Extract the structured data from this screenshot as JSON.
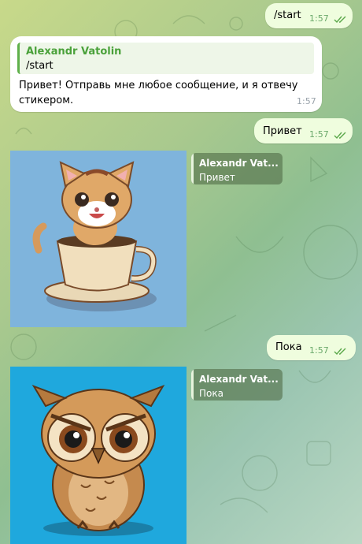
{
  "chat": {
    "messages": [
      {
        "id": "m1",
        "text": "/start",
        "time": "1:57"
      },
      {
        "id": "m2",
        "reply_name": "Alexandr Vatolin",
        "reply_text": "/start",
        "text": "Привет! Отправь мне любое сообщение, и я отвечу стикером.",
        "time": "1:57"
      },
      {
        "id": "m3",
        "text": "Привет",
        "time": "1:57"
      },
      {
        "id": "m4",
        "reply_name": "Alexandr Vat...",
        "reply_text": "Привет",
        "sticker": "kitten-in-cup"
      },
      {
        "id": "m5",
        "text": "Пока",
        "time": "1:57"
      },
      {
        "id": "m6",
        "reply_name": "Alexandr Vat...",
        "reply_text": "Пока",
        "sticker": "owl"
      }
    ]
  },
  "colors": {
    "outgoing_bubble": "#effdde",
    "incoming_bubble": "#ffffff",
    "accent_green": "#4aa13a",
    "sticker1_bg": "#7fb4dc",
    "sticker2_bg": "#1fa8dd"
  }
}
